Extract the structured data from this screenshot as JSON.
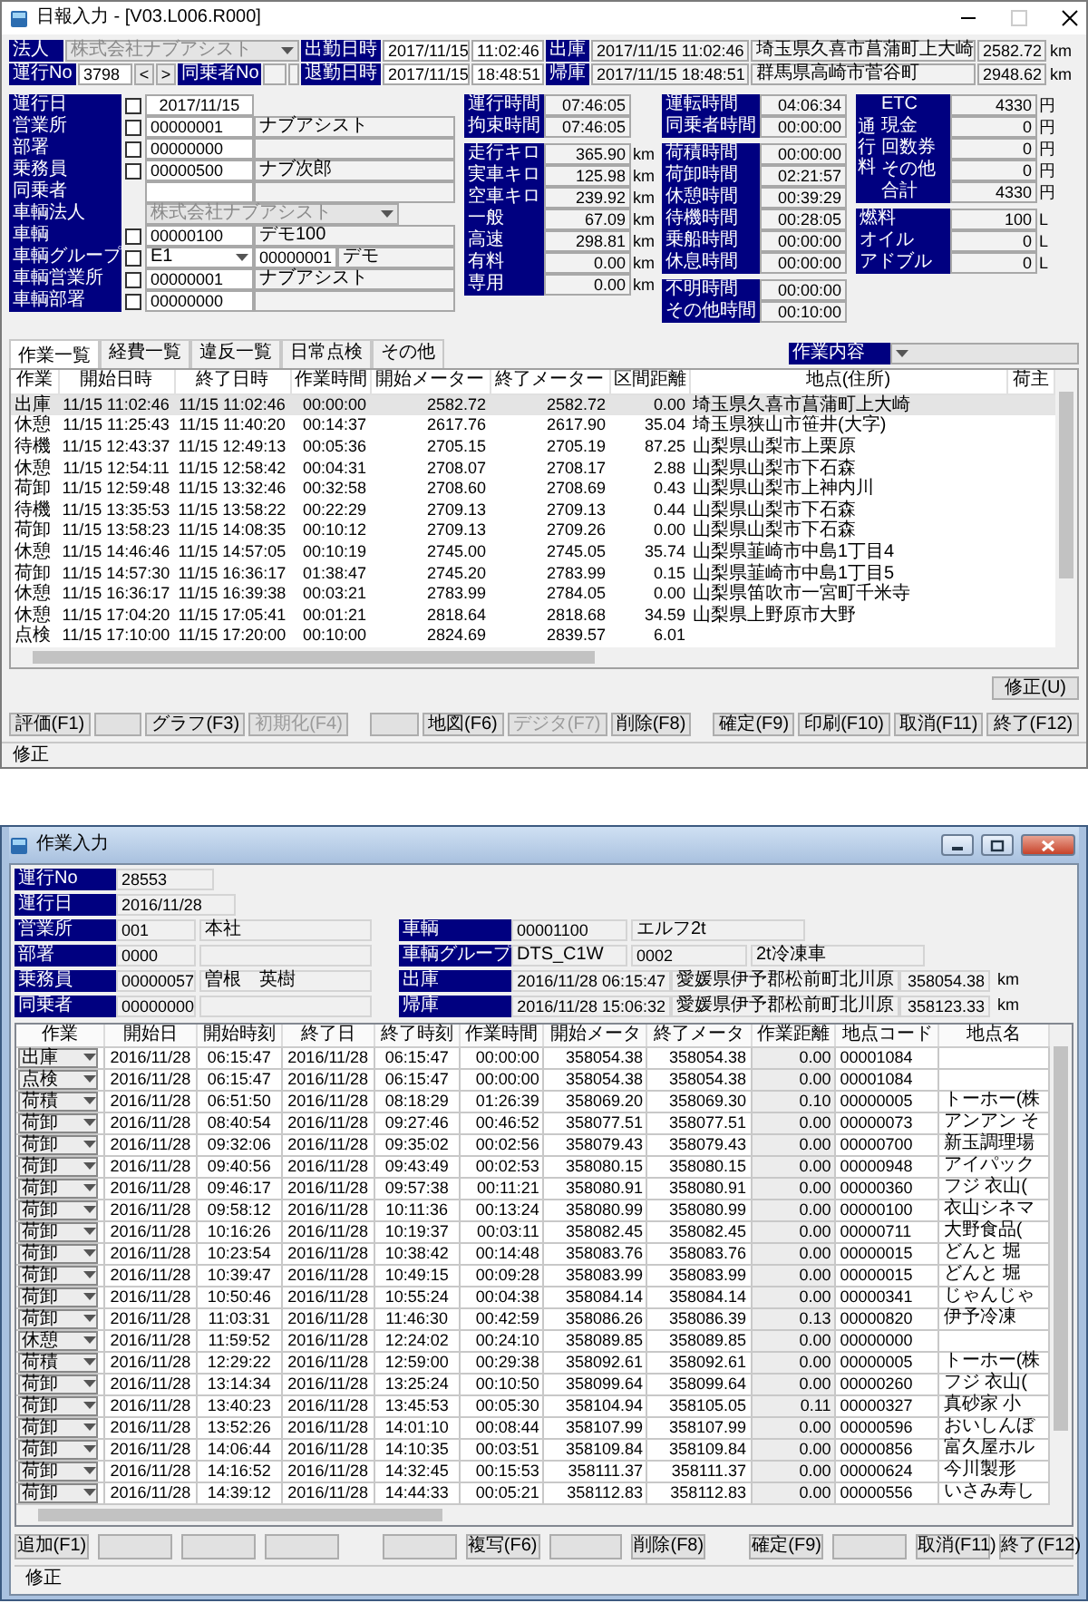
{
  "daily_report": {
    "title": "日報入力 - [V03.L006.R000]",
    "corp": {
      "label": "法人",
      "value": "株式会社ナブアシスト",
      "disabled": true
    },
    "run_no": {
      "label": "運行No",
      "value": "3798",
      "prev": "<",
      "next": ">"
    },
    "partner_no": {
      "label": "同乗者No"
    },
    "shifts": [
      {
        "label": "出勤日時",
        "date": "2017/11/15",
        "time": "11:02:46",
        "depot_label": "出庫",
        "depot_time": "2017/11/15 11:02:46",
        "place": "埼玉県久喜市菖蒲町上大崎",
        "meter": "2582.72",
        "unit": "km"
      },
      {
        "label": "退勤日時",
        "date": "2017/11/15",
        "time": "18:48:51",
        "depot_label": "帰庫",
        "depot_time": "2017/11/15 18:48:51",
        "place": "群馬県高崎市菅谷町",
        "meter": "2948.62",
        "unit": "km"
      }
    ],
    "form": [
      {
        "kind": "date",
        "label": "運行日",
        "checked": false,
        "value": "2017/11/15"
      },
      {
        "kind": "code",
        "label": "営業所",
        "checked": false,
        "code": "00000001",
        "name": "ナブアシスト"
      },
      {
        "kind": "code",
        "label": "部署",
        "checked": false,
        "code": "00000000"
      },
      {
        "kind": "code",
        "label": "乗務員",
        "checked": false,
        "code": "00000500",
        "name": "ナブ次郎"
      },
      {
        "kind": "code",
        "label": "同乗者"
      },
      {
        "kind": "select",
        "label": "車輌法人",
        "value": "株式会社ナブアシスト",
        "disabled": true
      },
      {
        "kind": "code",
        "label": "車輌",
        "checked": false,
        "code": "00000100",
        "name": "デモ100"
      },
      {
        "kind": "group",
        "label": "車輌グループ",
        "checked": false,
        "value": "E1",
        "code": "00000001",
        "name": "デモ"
      },
      {
        "kind": "code",
        "label": "車輌営業所",
        "checked": false,
        "code": "00000001",
        "name": "ナブアシスト"
      },
      {
        "kind": "code",
        "label": "車輌部署",
        "checked": false,
        "code": "00000000"
      }
    ],
    "times": [
      [
        {
          "label": "運行時間",
          "value": "07:46:05"
        },
        {
          "label": "拘束時間",
          "value": "07:46:05"
        }
      ],
      [
        {
          "label": "走行キロ",
          "value": "365.90",
          "unit": "km"
        },
        {
          "label": "実車キロ",
          "value": "125.98",
          "unit": "km"
        },
        {
          "label": "空車キロ",
          "value": "239.92",
          "unit": "km"
        },
        {
          "label": "一般",
          "value": "67.09",
          "unit": "km"
        },
        {
          "label": "高速",
          "value": "298.81",
          "unit": "km"
        },
        {
          "label": "有料",
          "value": "0.00",
          "unit": "km"
        },
        {
          "label": "専用",
          "value": "0.00",
          "unit": "km"
        }
      ]
    ],
    "durations": [
      [
        {
          "label": "運転時間",
          "value": "04:06:34"
        },
        {
          "label": "同乗者時間",
          "value": "00:00:00"
        }
      ],
      [
        {
          "label": "荷積時間",
          "value": "00:00:00"
        },
        {
          "label": "荷卸時間",
          "value": "02:21:57"
        },
        {
          "label": "休憩時間",
          "value": "00:39:29"
        },
        {
          "label": "待機時間",
          "value": "00:28:05"
        },
        {
          "label": "乗船時間",
          "value": "00:00:00"
        },
        {
          "label": "休息時間",
          "value": "00:00:00"
        }
      ],
      [
        {
          "label": "不明時間",
          "value": "00:00:00"
        },
        {
          "label": "その他時間",
          "value": "00:10:00"
        }
      ]
    ],
    "toll": {
      "label": "通行料",
      "rows": [
        {
          "label": "ETC",
          "value": "4330",
          "unit": "円"
        },
        {
          "label": "現金",
          "value": "0",
          "unit": "円"
        },
        {
          "label": "回数券",
          "value": "0",
          "unit": "円"
        },
        {
          "label": "その他",
          "value": "0",
          "unit": "円"
        },
        {
          "label": "合計",
          "value": "4330",
          "unit": "円"
        }
      ]
    },
    "consumables": [
      {
        "label": "燃料",
        "value": "100",
        "unit": "L"
      },
      {
        "label": "オイル",
        "value": "0",
        "unit": "L"
      },
      {
        "label": "アドブル",
        "value": "0",
        "unit": "L"
      }
    ],
    "tabs": [
      {
        "label": "作業一覧",
        "selected": true
      },
      {
        "label": "経費一覧",
        "selected": false
      },
      {
        "label": "違反一覧",
        "selected": false
      },
      {
        "label": "日常点検",
        "selected": false
      },
      {
        "label": "その他",
        "selected": false
      }
    ],
    "filter": {
      "label": "作業内容"
    },
    "table": {
      "columns": [
        "作業",
        "開始日時",
        "終了日時",
        "作業時間",
        "開始メーター",
        "終了メーター",
        "区間距離",
        "地点(住所)",
        "荷主"
      ],
      "rows": [
        {
          "selected": true,
          "cells": [
            "出庫",
            "11/15 11:02:46",
            "11/15 11:02:46",
            "00:00:00",
            "2582.72",
            "2582.72",
            "0.00",
            "埼玉県久喜市菖蒲町上大崎"
          ]
        },
        {
          "selected": false,
          "cells": [
            "休憩",
            "11/15 11:25:43",
            "11/15 11:40:20",
            "00:14:37",
            "2617.76",
            "2617.90",
            "35.04",
            "埼玉県狭山市笹井(大字)"
          ]
        },
        {
          "selected": false,
          "cells": [
            "待機",
            "11/15 12:43:37",
            "11/15 12:49:13",
            "00:05:36",
            "2705.15",
            "2705.19",
            "87.25",
            "山梨県山梨市上栗原"
          ]
        },
        {
          "selected": false,
          "cells": [
            "休憩",
            "11/15 12:54:11",
            "11/15 12:58:42",
            "00:04:31",
            "2708.07",
            "2708.17",
            "2.88",
            "山梨県山梨市下石森"
          ]
        },
        {
          "selected": false,
          "cells": [
            "荷卸",
            "11/15 12:59:48",
            "11/15 13:32:46",
            "00:32:58",
            "2708.60",
            "2708.69",
            "0.43",
            "山梨県山梨市上神内川"
          ]
        },
        {
          "selected": false,
          "cells": [
            "待機",
            "11/15 13:35:53",
            "11/15 13:58:22",
            "00:22:29",
            "2709.13",
            "2709.13",
            "0.44",
            "山梨県山梨市下石森"
          ]
        },
        {
          "selected": false,
          "cells": [
            "荷卸",
            "11/15 13:58:23",
            "11/15 14:08:35",
            "00:10:12",
            "2709.13",
            "2709.26",
            "0.00",
            "山梨県山梨市下石森"
          ]
        },
        {
          "selected": false,
          "cells": [
            "休憩",
            "11/15 14:46:46",
            "11/15 14:57:05",
            "00:10:19",
            "2745.00",
            "2745.05",
            "35.74",
            "山梨県韮崎市中島1丁目4"
          ]
        },
        {
          "selected": false,
          "cells": [
            "荷卸",
            "11/15 14:57:30",
            "11/15 16:36:17",
            "01:38:47",
            "2745.20",
            "2783.99",
            "0.15",
            "山梨県韮崎市中島1丁目5"
          ]
        },
        {
          "selected": false,
          "cells": [
            "休憩",
            "11/15 16:36:17",
            "11/15 16:39:38",
            "00:03:21",
            "2783.99",
            "2784.05",
            "0.00",
            "山梨県笛吹市一宮町千米寺"
          ]
        },
        {
          "selected": false,
          "cells": [
            "休憩",
            "11/15 17:04:20",
            "11/15 17:05:41",
            "00:01:21",
            "2818.64",
            "2818.68",
            "34.59",
            "山梨県上野原市大野"
          ]
        },
        {
          "selected": false,
          "cells": [
            "点検",
            "11/15 17:10:00",
            "11/15 17:20:00",
            "00:10:00",
            "2824.69",
            "2839.57",
            "6.01"
          ]
        }
      ]
    },
    "edit_button": "修正(U)",
    "buttons": [
      {
        "kind": "command",
        "label": "評価(F1)",
        "disabled": false
      },
      {
        "kind": "blank"
      },
      {
        "kind": "command",
        "label": "グラフ(F3)",
        "disabled": false
      },
      {
        "kind": "command",
        "label": "初期化(F4)",
        "disabled": true
      },
      {
        "kind": "blank"
      },
      {
        "kind": "command",
        "label": "地図(F6)",
        "disabled": false
      },
      {
        "kind": "command",
        "label": "デジタ(F7)",
        "disabled": true
      },
      {
        "kind": "command",
        "label": "削除(F8)",
        "disabled": false
      },
      {
        "kind": "command",
        "label": "確定(F9)",
        "disabled": false
      },
      {
        "kind": "command",
        "label": "印刷(F10)",
        "disabled": false
      },
      {
        "kind": "command",
        "label": "取消(F11)",
        "disabled": false
      },
      {
        "kind": "command",
        "label": "終了(F12)",
        "disabled": false
      }
    ],
    "status": "修正"
  },
  "work_entry": {
    "title": "作業入力",
    "fields": [
      {
        "left": {
          "kind": "single",
          "label": "運行No",
          "code": "28553"
        }
      },
      {
        "left": {
          "kind": "single",
          "label": "運行日",
          "code": "2016/11/28"
        }
      },
      {
        "left": {
          "kind": "pair",
          "label": "営業所",
          "code": "001",
          "name": "本社"
        },
        "right": {
          "kind": "pair",
          "label": "車輌",
          "code": "00001100",
          "name": "エルフ2t"
        }
      },
      {
        "left": {
          "kind": "pair",
          "label": "部署",
          "code": "0000"
        },
        "right": {
          "kind": "group",
          "label": "車輌グループ",
          "code": "DTS_C1W",
          "sub_code": "0002",
          "name": "2t冷凍車"
        }
      },
      {
        "left": {
          "kind": "pair",
          "label": "乗務員",
          "code": "00000057",
          "name": "曽根　英樹"
        },
        "right": {
          "kind": "depot",
          "label": "出庫",
          "datetime": "2016/11/28 06:15:47",
          "place": "愛媛県伊予郡松前町北川原",
          "meter": "358054.38",
          "unit": "km"
        }
      },
      {
        "left": {
          "kind": "pair",
          "label": "同乗者",
          "code": "00000000"
        },
        "right": {
          "kind": "depot",
          "label": "帰庫",
          "datetime": "2016/11/28 15:06:32",
          "place": "愛媛県伊予郡松前町北川原",
          "meter": "358123.33",
          "unit": "km"
        }
      }
    ],
    "table": {
      "columns": [
        "作業",
        "開始日",
        "開始時刻",
        "終了日",
        "終了時刻",
        "作業時間",
        "開始メータ",
        "終了メータ",
        "作業距離",
        "地点コード",
        "地点名"
      ],
      "rows": [
        [
          "出庫",
          "2016/11/28",
          "06:15:47",
          "2016/11/28",
          "06:15:47",
          "00:00:00",
          "358054.38",
          "358054.38",
          "0.00",
          "00001084"
        ],
        [
          "点検",
          "2016/11/28",
          "06:15:47",
          "2016/11/28",
          "06:15:47",
          "00:00:00",
          "358054.38",
          "358054.38",
          "0.00",
          "00001084"
        ],
        [
          "荷積",
          "2016/11/28",
          "06:51:50",
          "2016/11/28",
          "08:18:29",
          "01:26:39",
          "358069.20",
          "358069.30",
          "0.10",
          "00000005",
          "トーホー(株"
        ],
        [
          "荷卸",
          "2016/11/28",
          "08:40:54",
          "2016/11/28",
          "09:27:46",
          "00:46:52",
          "358077.51",
          "358077.51",
          "0.00",
          "00000073",
          "アンアン そ"
        ],
        [
          "荷卸",
          "2016/11/28",
          "09:32:06",
          "2016/11/28",
          "09:35:02",
          "00:02:56",
          "358079.43",
          "358079.43",
          "0.00",
          "00000700",
          "新玉調理場"
        ],
        [
          "荷卸",
          "2016/11/28",
          "09:40:56",
          "2016/11/28",
          "09:43:49",
          "00:02:53",
          "358080.15",
          "358080.15",
          "0.00",
          "00000948",
          "アイパック"
        ],
        [
          "荷卸",
          "2016/11/28",
          "09:46:17",
          "2016/11/28",
          "09:57:38",
          "00:11:21",
          "358080.91",
          "358080.91",
          "0.00",
          "00000360",
          "フジ 衣山("
        ],
        [
          "荷卸",
          "2016/11/28",
          "09:58:12",
          "2016/11/28",
          "10:11:36",
          "00:13:24",
          "358080.99",
          "358080.99",
          "0.00",
          "00000100",
          "衣山シネマ"
        ],
        [
          "荷卸",
          "2016/11/28",
          "10:16:26",
          "2016/11/28",
          "10:19:37",
          "00:03:11",
          "358082.45",
          "358082.45",
          "0.00",
          "00000711",
          "大野食品("
        ],
        [
          "荷卸",
          "2016/11/28",
          "10:23:54",
          "2016/11/28",
          "10:38:42",
          "00:14:48",
          "358083.76",
          "358083.76",
          "0.00",
          "00000015",
          "どんと 堀"
        ],
        [
          "荷卸",
          "2016/11/28",
          "10:39:47",
          "2016/11/28",
          "10:49:15",
          "00:09:28",
          "358083.99",
          "358083.99",
          "0.00",
          "00000015",
          "どんと 堀"
        ],
        [
          "荷卸",
          "2016/11/28",
          "10:50:46",
          "2016/11/28",
          "10:55:24",
          "00:04:38",
          "358084.14",
          "358084.14",
          "0.00",
          "00000341",
          "じゃんじゃ"
        ],
        [
          "荷卸",
          "2016/11/28",
          "11:03:31",
          "2016/11/28",
          "11:46:30",
          "00:42:59",
          "358086.26",
          "358086.39",
          "0.13",
          "00000820",
          "伊予冷凍"
        ],
        [
          "休憩",
          "2016/11/28",
          "11:59:52",
          "2016/11/28",
          "12:24:02",
          "00:24:10",
          "358089.85",
          "358089.85",
          "0.00",
          "00000000"
        ],
        [
          "荷積",
          "2016/11/28",
          "12:29:22",
          "2016/11/28",
          "12:59:00",
          "00:29:38",
          "358092.61",
          "358092.61",
          "0.00",
          "00000005",
          "トーホー(株"
        ],
        [
          "荷卸",
          "2016/11/28",
          "13:14:34",
          "2016/11/28",
          "13:25:24",
          "00:10:50",
          "358099.64",
          "358099.64",
          "0.00",
          "00000260",
          "フジ 衣山("
        ],
        [
          "荷卸",
          "2016/11/28",
          "13:40:23",
          "2016/11/28",
          "13:45:53",
          "00:05:30",
          "358104.94",
          "358105.05",
          "0.11",
          "00000327",
          "真砂家 小"
        ],
        [
          "荷卸",
          "2016/11/28",
          "13:52:26",
          "2016/11/28",
          "14:01:10",
          "00:08:44",
          "358107.99",
          "358107.99",
          "0.00",
          "00000596",
          "おいしんぼ"
        ],
        [
          "荷卸",
          "2016/11/28",
          "14:06:44",
          "2016/11/28",
          "14:10:35",
          "00:03:51",
          "358109.84",
          "358109.84",
          "0.00",
          "00000856",
          "富久屋ホル"
        ],
        [
          "荷卸",
          "2016/11/28",
          "14:16:52",
          "2016/11/28",
          "14:32:45",
          "00:15:53",
          "358111.37",
          "358111.37",
          "0.00",
          "00000624",
          "今川製形"
        ],
        [
          "荷卸",
          "2016/11/28",
          "14:39:12",
          "2016/11/28",
          "14:44:33",
          "00:05:21",
          "358112.83",
          "358112.83",
          "0.00",
          "00000556",
          "いさみ寿し"
        ]
      ]
    },
    "buttons": [
      {
        "kind": "command",
        "label": "追加(F1)"
      },
      {
        "kind": "blank"
      },
      {
        "kind": "blank"
      },
      {
        "kind": "blank"
      },
      {
        "kind": "blank"
      },
      {
        "kind": "command",
        "label": "複写(F6)"
      },
      {
        "kind": "blank"
      },
      {
        "kind": "command",
        "label": "削除(F8)"
      },
      {
        "kind": "command",
        "label": "確定(F9)"
      },
      {
        "kind": "blank"
      },
      {
        "kind": "command",
        "label": "取消(F11)"
      },
      {
        "kind": "command",
        "label": "終了(F12)"
      }
    ],
    "status": "修正"
  }
}
